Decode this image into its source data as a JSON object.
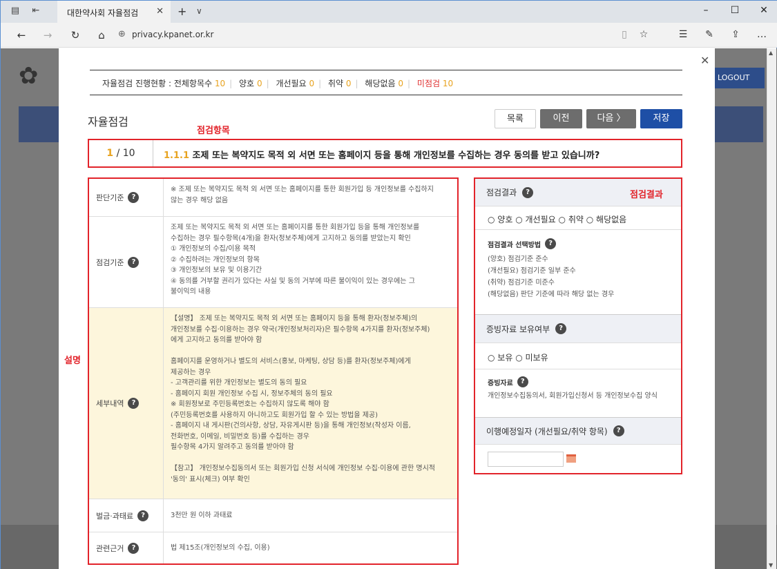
{
  "browser": {
    "tab_title": "대한약사회 자율점검",
    "url": "privacy.kpanet.or.kr"
  },
  "background": {
    "logout_label": "LOGOUT"
  },
  "progress": {
    "label": "자율점검 진행현황 :",
    "items": [
      {
        "label": "전체항목수",
        "value": "10"
      },
      {
        "label": "양호",
        "value": "0"
      },
      {
        "label": "개선필요",
        "value": "0"
      },
      {
        "label": "취약",
        "value": "0"
      },
      {
        "label": "해당없음",
        "value": "0"
      },
      {
        "label": "미점검",
        "value": "10"
      }
    ]
  },
  "page_title": "자율점검",
  "buttons": {
    "list": "목록",
    "prev": "이전",
    "next": "다음 〉",
    "save": "저장"
  },
  "annotations": {
    "item": "점검항목",
    "explain": "설명",
    "result": "점검결과"
  },
  "question": {
    "current": "1",
    "total": "/ 10",
    "number": "1.1.1",
    "text": "조제 또는 복약지도 목적 외 서면 또는 홈페이지 등을 통해 개인정보를 수집하는 경우 동의를 받고 있습니까?"
  },
  "rows": [
    {
      "head": "판단기준",
      "body": "※ 조제 또는 복약지도 목적 외 서면 또는 홈페이지를 통한 회원가입 등 개인정보를 수집하지\n않는 경우 해당 없음"
    },
    {
      "head": "점검기준",
      "body": "조제 또는 복약지도 목적 외 서면 또는 홈페이지를 통한 회원가입 등을 통해 개인정보를\n수집하는 경우 필수항목(4개)을 환자(정보주체)에게 고지하고 동의를 받았는지 확인\n① 개인정보의 수집/이용 목적\n② 수집하려는 개인정보의 항목\n③ 개인정보의 보유 및 이용기간\n④ 동의를 거부할 권리가 있다는 사실 및 동의 거부에 따른 불이익이 있는 경우에는 그\n불이익의 내용"
    },
    {
      "head": "세부내역",
      "body": "【설명】 조제 또는 복약지도 목적 외 서면 또는 홈페이지 등을 통해 환자(정보주체)의\n개인정보를 수집·이용하는 경우 약국(개인정보처리자)은 필수항목 4가지를 환자(정보주체)\n에게 고지하고 동의를 받아야 함\n\n홈페이지를 운영하거나 별도의 서비스(홍보, 마케팅, 상담 등)를 환자(정보주체)에게\n제공하는 경우\n- 고객관리를 위한 개인정보는 별도의 동의 필요\n- 홈페이지 회원 개인정보 수집 시, 정보주체의 동의 필요\n※ 회원정보로 주민등록번호는 수집하지 않도록 해야 함\n(주민등록번호를 사용하지 아니하고도 회원가입 할 수 있는 방법을 제공)\n- 홈페이지 내 게시판(건의사항, 상담, 자유게시판 등)을 통해 개인정보(작성자 이름,\n전화번호, 이메일, 비밀번호 등)를 수집하는 경우\n필수항목 4가지 알려주고 동의를 받아야 함\n\n【참고】 개인정보수집동의서 또는 회원가입 신청 서식에 개인정보 수집·이용에 관한 명시적\n'동의' 표시(체크) 여부 확인"
    },
    {
      "head": "벌금·과태료",
      "body": "3천만 원 이하 과태료"
    },
    {
      "head": "관련근거",
      "body": "법 제15조(개인정보의 수집, 이용)"
    }
  ],
  "result": {
    "title": "점검결과",
    "options": [
      "양호",
      "개선필요",
      "취약",
      "해당없음"
    ],
    "method_title": "점검결과 선택방법",
    "method_lines": [
      "(양호) 점검기준 준수",
      "(개선필요) 점검기준 일부 준수",
      "(취약) 점검기준 미준수",
      "(해당없음) 판단 기준에 따라 해당 없는 경우"
    ],
    "evidence_title": "증빙자료 보유여부",
    "evidence_options": [
      "보유",
      "미보유"
    ],
    "evidence_sub_title": "증빙자료",
    "evidence_text": "개인정보수집동의서, 회원가입신청서 등 개인정보수집 양식",
    "date_title": "이행예정일자 (개선필요/취약 항목)"
  },
  "colors": {
    "accent": "#e8a320",
    "annotation": "#e2232a",
    "save": "#1e4fa6"
  }
}
